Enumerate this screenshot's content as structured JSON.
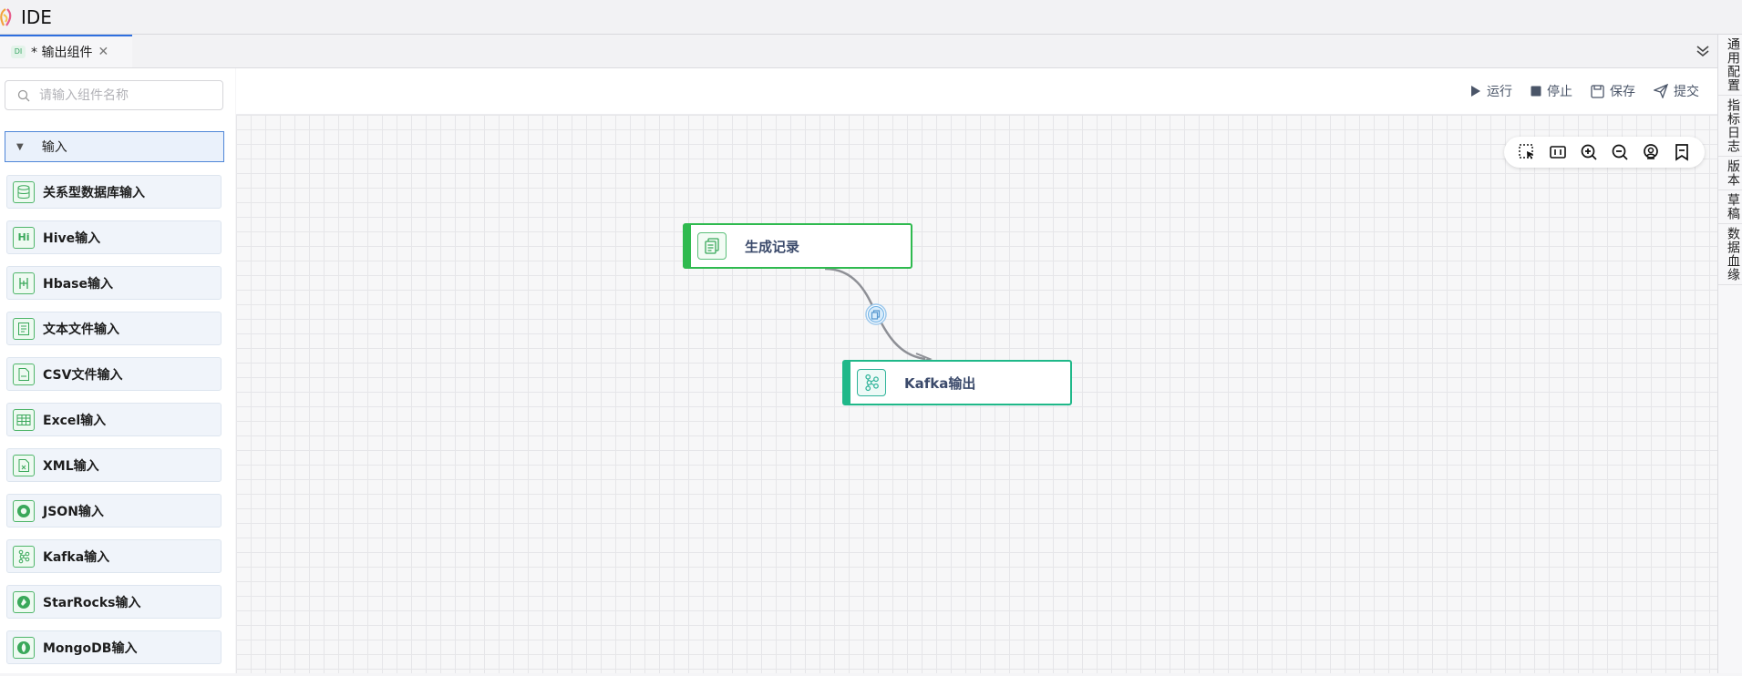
{
  "app": {
    "title": "IDE"
  },
  "tabs": [
    {
      "badge": "DI",
      "label": "* 输出组件"
    }
  ],
  "sidebar": {
    "search_placeholder": "请输入组件名称",
    "group_label": "输入",
    "items": [
      {
        "label": "关系型数据库输入",
        "icon": "database-icon"
      },
      {
        "label": "Hive输入",
        "icon": "hive-icon"
      },
      {
        "label": "Hbase输入",
        "icon": "hbase-icon"
      },
      {
        "label": "文本文件输入",
        "icon": "text-file-icon"
      },
      {
        "label": "CSV文件输入",
        "icon": "csv-file-icon"
      },
      {
        "label": "Excel输入",
        "icon": "excel-table-icon"
      },
      {
        "label": "XML输入",
        "icon": "xml-file-icon"
      },
      {
        "label": "JSON输入",
        "icon": "json-icon"
      },
      {
        "label": "Kafka输入",
        "icon": "kafka-icon"
      },
      {
        "label": "StarRocks输入",
        "icon": "starrocks-icon"
      },
      {
        "label": "MongoDB输入",
        "icon": "mongodb-icon"
      }
    ]
  },
  "toolbar": {
    "run": "运行",
    "stop": "停止",
    "save": "保存",
    "submit": "提交"
  },
  "right_panel": [
    "通用配置",
    "指标日志",
    "版本",
    "草稿",
    "数据血缘"
  ],
  "canvas": {
    "nodes": [
      {
        "label": "生成记录",
        "icon": "generate-record-icon"
      },
      {
        "label": "Kafka输出",
        "icon": "kafka-icon"
      }
    ]
  },
  "colors": {
    "accent_blue": "#2f6fdf",
    "node_green": "#2fba4f",
    "node_teal": "#1fb889",
    "text_muted": "#4a5568"
  }
}
